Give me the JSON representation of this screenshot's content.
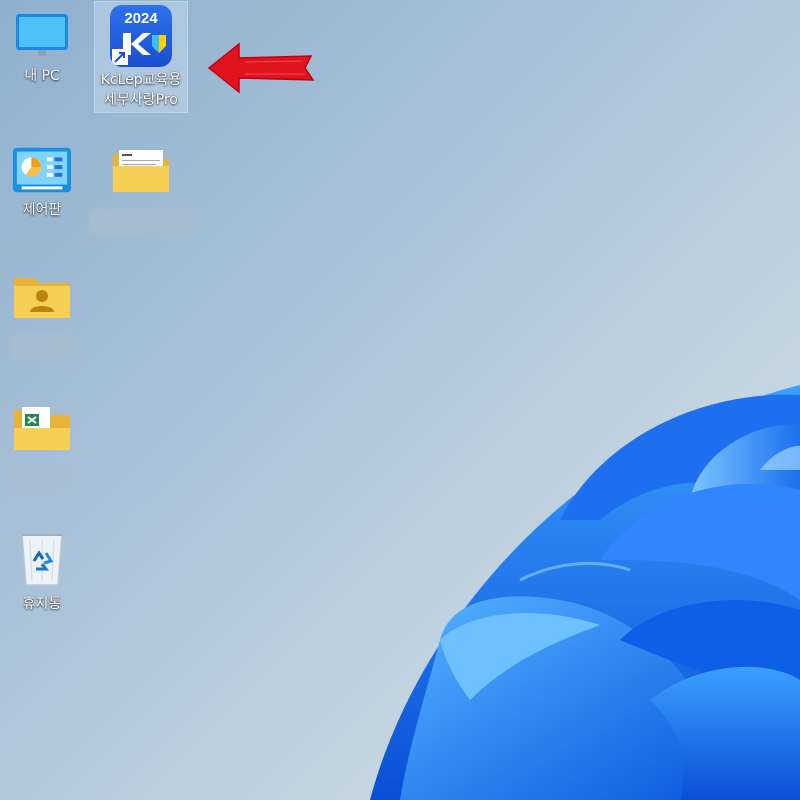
{
  "desktop": {
    "icons": [
      {
        "id": "my-pc",
        "label": "내 PC",
        "icon": "monitor-icon"
      },
      {
        "id": "kclep",
        "label": "KcLep교육용\n세무사랑Pro",
        "badge": "2024",
        "icon": "kclep-app-icon",
        "shortcut": true,
        "selected": true
      },
      {
        "id": "control-panel",
        "label": "제어판",
        "icon": "control-panel-icon"
      },
      {
        "id": "folder-docs",
        "label": "",
        "icon": "folder-icon",
        "label_obscured": true
      },
      {
        "id": "folder-user",
        "label": "",
        "icon": "user-folder-icon",
        "label_obscured": true
      },
      {
        "id": "folder-excel",
        "label": "",
        "icon": "excel-folder-icon",
        "label_obscured": true
      },
      {
        "id": "recycle-bin",
        "label": "휴지통",
        "icon": "recycle-bin-icon"
      }
    ]
  },
  "annotation": {
    "icon": "red-arrow-icon",
    "color": "#e0141e",
    "points_to": "kclep"
  },
  "colors": {
    "wallpaper_bg": "#a9c2d8",
    "bloom_blue": "#1f6fe8",
    "folder_yellow": "#f6c94e",
    "kclep_blue": "#2a65e6"
  }
}
